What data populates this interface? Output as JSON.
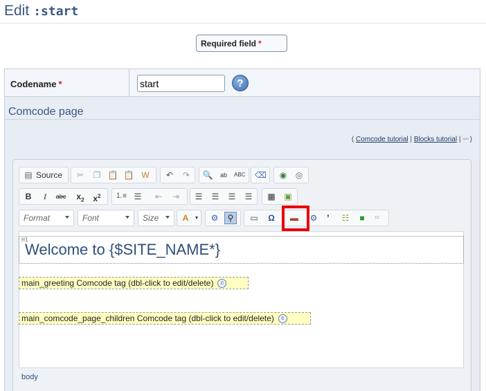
{
  "header": {
    "edit_label": "Edit",
    "page_code": ":start"
  },
  "required": {
    "label": "Required field",
    "star": "*"
  },
  "codename": {
    "label": "Codename",
    "star": "*",
    "value": "start",
    "help_symbol": "?"
  },
  "comcode_section": {
    "title": "Comcode page"
  },
  "tutorials": {
    "open": "(",
    "link1": "Comcode tutorial",
    "sep": "|",
    "link2": "Blocks tutorial",
    "sep2": "|",
    "close": ")"
  },
  "toolbar": {
    "source_label": "Source",
    "format_placeholder": "Format",
    "font_placeholder": "Font",
    "size_placeholder": "Size",
    "subscript": "x",
    "superscript": "x",
    "bold": "B",
    "italic": "I",
    "strike": "abc"
  },
  "editor": {
    "h1_tag": "H1",
    "heading": "Welcome to {$SITE_NAME*}",
    "block1": "main_greeting Comcode tag (dbl-click to edit/delete)",
    "block2": "main_comcode_page_children Comcode tag (dbl-click to edit/delete)",
    "element_path": "body"
  }
}
